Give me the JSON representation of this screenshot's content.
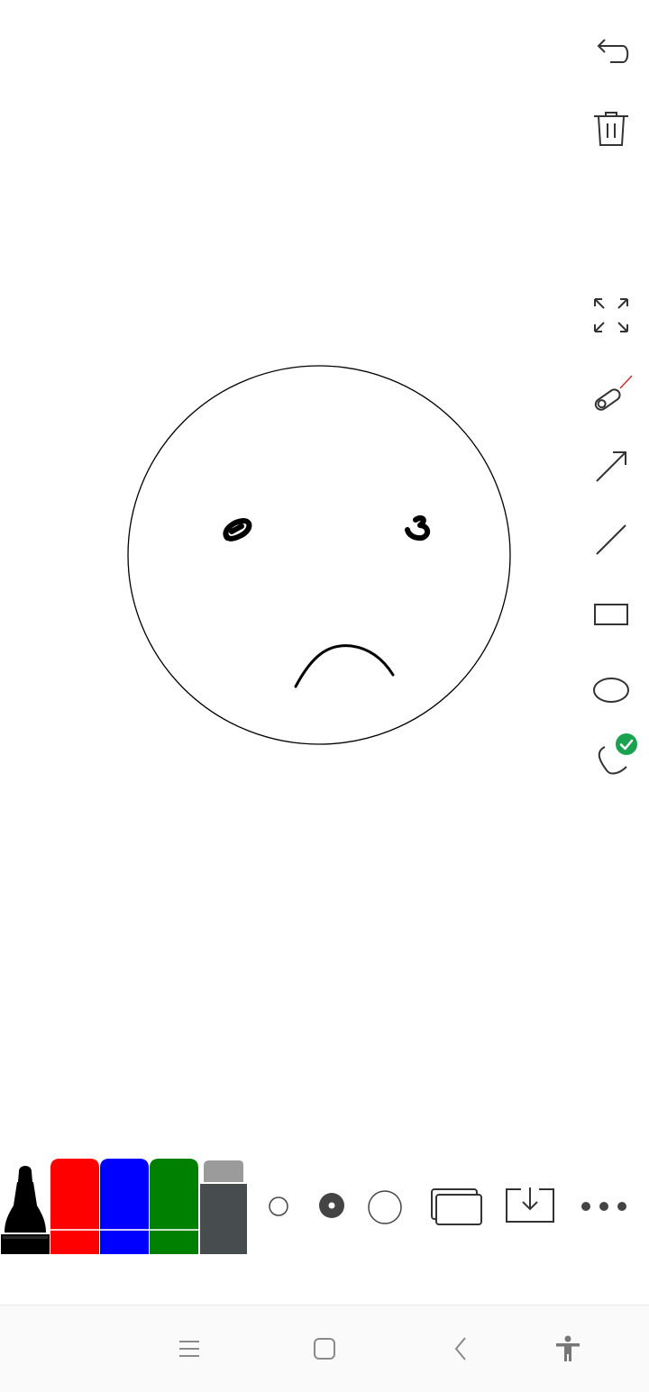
{
  "toolbar_right": {
    "tools": [
      {
        "name": "undo",
        "icon": "undo-icon"
      },
      {
        "name": "delete",
        "icon": "trash-icon"
      },
      {
        "name": "fullscreen",
        "icon": "expand-icon"
      },
      {
        "name": "laser-pointer",
        "icon": "laser-pointer-icon"
      },
      {
        "name": "arrow",
        "icon": "arrow-icon"
      },
      {
        "name": "line",
        "icon": "line-icon"
      },
      {
        "name": "rectangle",
        "icon": "rectangle-icon"
      },
      {
        "name": "ellipse",
        "icon": "ellipse-icon"
      },
      {
        "name": "freehand",
        "icon": "freehand-icon",
        "selected": true
      }
    ]
  },
  "colors": {
    "marker_black": "#000000",
    "marker_red": "#ff0000",
    "marker_blue": "#0000ff",
    "marker_green": "#008000",
    "eraser_dark": "#474c4f",
    "eraser_cap": "#9b9b9b",
    "selected_check": "#1aa251",
    "stroke": "#000000"
  },
  "bottom_toolbar": {
    "markers": [
      "black",
      "red",
      "blue",
      "green",
      "eraser"
    ],
    "stroke_sizes": [
      "small",
      "medium",
      "large"
    ],
    "selected_stroke_size": "medium",
    "actions": [
      {
        "name": "pages",
        "icon": "pages-icon"
      },
      {
        "name": "save",
        "icon": "download-icon"
      },
      {
        "name": "more",
        "icon": "more-icon"
      }
    ]
  },
  "nav_bar": {
    "buttons": [
      {
        "name": "recents",
        "icon": "menu-icon"
      },
      {
        "name": "home",
        "icon": "home-icon"
      },
      {
        "name": "back",
        "icon": "back-icon"
      },
      {
        "name": "accessibility",
        "icon": "accessibility-icon"
      }
    ]
  }
}
